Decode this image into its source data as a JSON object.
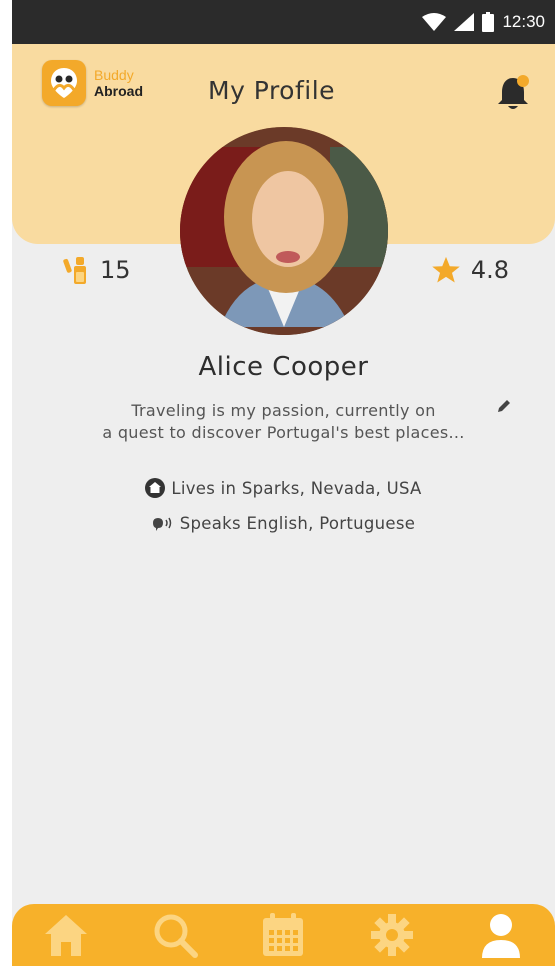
{
  "status_bar": {
    "time": "12:30"
  },
  "header": {
    "logo_line1": "Buddy",
    "logo_line2": "Abroad",
    "title": "My Profile"
  },
  "stats": {
    "trips": "15",
    "rating": "4.8"
  },
  "profile": {
    "name": "Alice Cooper",
    "bio_line1": "Traveling is my passion, currently on",
    "bio_line2": "a quest to discover Portugal's best places...",
    "lives": "Lives in Sparks, Nevada, USA",
    "speaks": "Speaks English, Portuguese"
  },
  "nav": {
    "items": [
      {
        "icon": "home-icon"
      },
      {
        "icon": "search-icon"
      },
      {
        "icon": "calendar-icon"
      },
      {
        "icon": "gear-icon"
      },
      {
        "icon": "user-icon",
        "active": true
      }
    ]
  },
  "colors": {
    "accent": "#f7b12a",
    "header_bg": "#f9dba0",
    "page_bg": "#eeeeee",
    "active_nav_icon": "#ffffff",
    "inactive_nav_icon": "#fcd582"
  }
}
